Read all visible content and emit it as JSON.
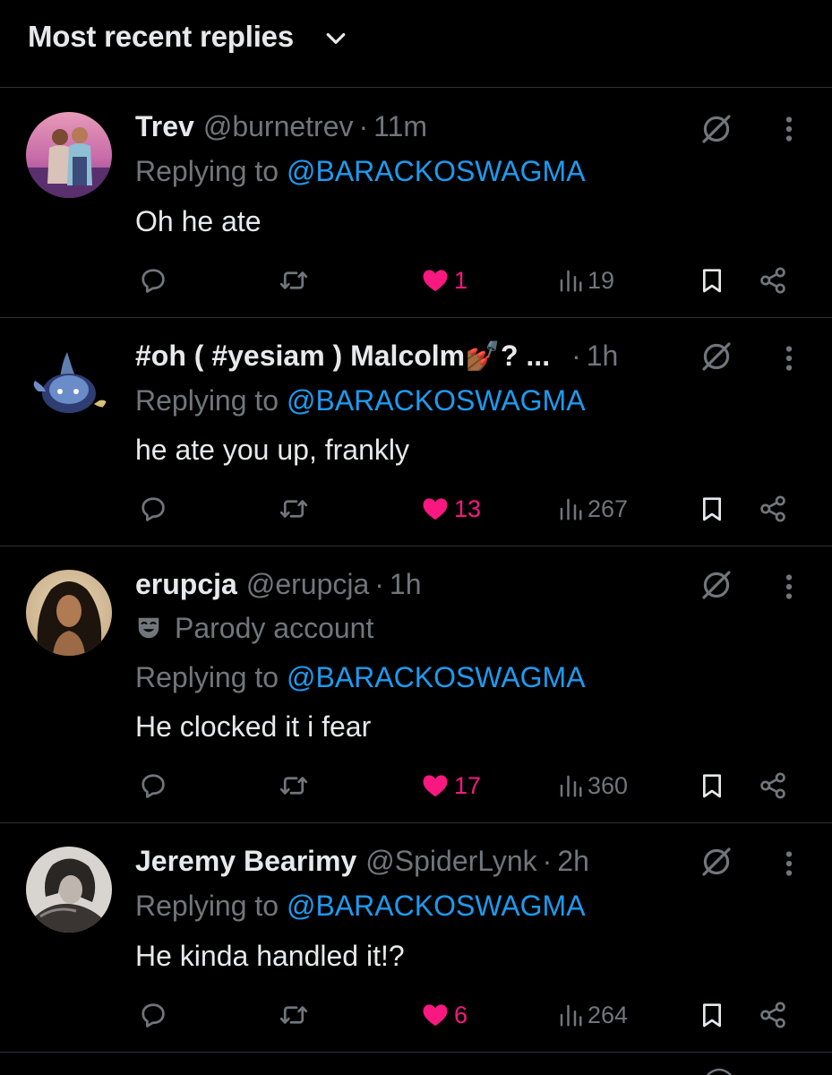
{
  "sort": {
    "label": "Most recent replies"
  },
  "icons": {
    "sort_chevron": "chevron-down-icon",
    "grok": "grok-icon",
    "more": "more-vertical-icon",
    "reply": "reply-icon",
    "retweet": "retweet-icon",
    "like": "heart-icon",
    "views": "views-icon",
    "bookmark": "bookmark-icon",
    "share": "share-icon",
    "parody": "mask-icon"
  },
  "colors": {
    "background": "#000000",
    "text": "#e7e9ea",
    "muted": "#71767b",
    "mention": "#1d9bf0",
    "like": "#f91880",
    "divider": "#2f3336"
  },
  "replies": [
    {
      "name": "Trev",
      "handle": "@burnetrev",
      "separator": "·",
      "time": "11m",
      "replying_prefix": "Replying to ",
      "replying_to": "@BARACKOSWAGMA",
      "text": "Oh he ate",
      "likes": "1",
      "views": "19",
      "liked": true
    },
    {
      "name": "#oh ( #yesiam ) Malcolm💅🏾? ...",
      "handle": "",
      "separator": "·",
      "time": "1h",
      "replying_prefix": "Replying to ",
      "replying_to": "@BARACKOSWAGMA",
      "text": "he ate you up, frankly",
      "likes": "13",
      "views": "267",
      "liked": true
    },
    {
      "name": "erupcja",
      "handle": "@erupcja",
      "separator": "·",
      "time": "1h",
      "badge": "Parody account",
      "replying_prefix": "Replying to ",
      "replying_to": "@BARACKOSWAGMA",
      "text": "He clocked it i fear",
      "likes": "17",
      "views": "360",
      "liked": true
    },
    {
      "name": "Jeremy Bearimy",
      "handle": "@SpiderLynk",
      "separator": "·",
      "time": "2h",
      "replying_prefix": "Replying to ",
      "replying_to": "@BARACKOSWAGMA",
      "text": "He kinda handled it!?",
      "likes": "6",
      "views": "264",
      "liked": true
    }
  ]
}
